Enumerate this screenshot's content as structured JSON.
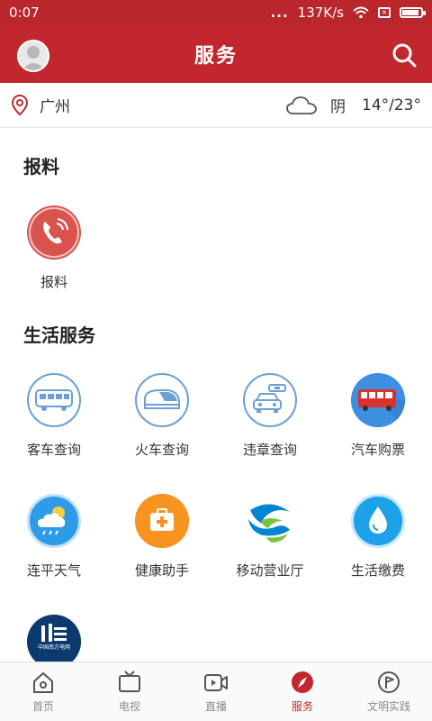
{
  "statusbar": {
    "time": "0:07",
    "signal": "...",
    "speed": "137K/s"
  },
  "header": {
    "title": "服务",
    "avatar": "avatar",
    "search_icon": "search-icon"
  },
  "location": {
    "city": "广州",
    "icon": "location-pin-icon"
  },
  "weather": {
    "icon": "cloud-icon",
    "condition": "阴",
    "temperature": "14°/23°"
  },
  "sections": {
    "report": {
      "title": "报料",
      "items": [
        {
          "label": "报料",
          "icon": "phone-report-icon"
        }
      ]
    },
    "life": {
      "title": "生活服务",
      "items": [
        {
          "label": "客车查询",
          "icon": "bus-icon"
        },
        {
          "label": "火车查询",
          "icon": "train-icon"
        },
        {
          "label": "违章查询",
          "icon": "car-violation-icon"
        },
        {
          "label": "汽车购票",
          "icon": "bus-ticket-icon"
        },
        {
          "label": "连平天气",
          "icon": "weather-icon"
        },
        {
          "label": "健康助手",
          "icon": "health-kit-icon"
        },
        {
          "label": "移动营业厅",
          "icon": "china-mobile-icon"
        },
        {
          "label": "生活缴费",
          "icon": "water-drop-icon"
        },
        {
          "label": "",
          "icon": "china-southern-grid-icon",
          "logo_text": "中国南方电网"
        }
      ]
    }
  },
  "tabbar": {
    "items": [
      {
        "label": "首页",
        "icon": "home-icon"
      },
      {
        "label": "电视",
        "icon": "tv-icon"
      },
      {
        "label": "直播",
        "icon": "live-video-icon"
      },
      {
        "label": "服务",
        "icon": "compass-icon",
        "active": true
      },
      {
        "label": "文明实践",
        "icon": "flag-icon"
      }
    ]
  },
  "colors": {
    "brand_red": "#c1272d",
    "icon_blue": "#6b9fd6",
    "tab_inactive": "#8a8a8a"
  }
}
